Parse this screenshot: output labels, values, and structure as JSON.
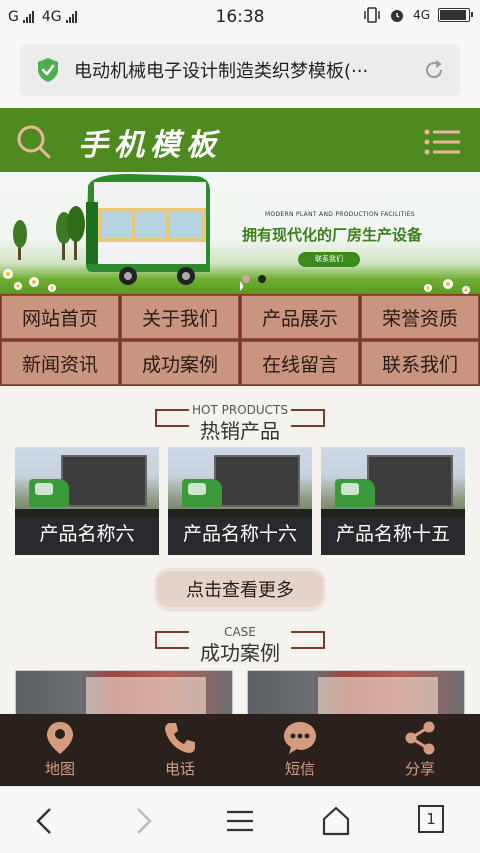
{
  "status_bar": {
    "carrier1": "G",
    "carrier2": "4G",
    "time": "16:38",
    "net": "4G"
  },
  "address_bar": {
    "title": "电动机械电子设计制造类织梦模板(···",
    "secure_icon": "shield-check-icon",
    "reload_icon": "reload-icon"
  },
  "site_header": {
    "logo": "手机模板",
    "color": "#4e8a1f"
  },
  "banner": {
    "subtitle": "MODERN PLANT AND PRODUCTION FACILITIES",
    "headline": "拥有现代化的厂房生产设备",
    "button": "联系我们",
    "active_slide": 2,
    "slides": 2
  },
  "nav": [
    "网站首页",
    "关于我们",
    "产品展示",
    "荣誉资质",
    "新闻资讯",
    "成功案例",
    "在线留言",
    "联系我们"
  ],
  "hot_products": {
    "en": "HOT PRODUCTS",
    "cn": "热销产品",
    "items": [
      "产品名称六",
      "产品名称十六",
      "产品名称十五"
    ],
    "more": "点击查看更多"
  },
  "cases": {
    "en": "CASE",
    "cn": "成功案例"
  },
  "toolbar": {
    "items": [
      {
        "label": "地图",
        "icon": "map-pin-icon"
      },
      {
        "label": "电话",
        "icon": "phone-icon"
      },
      {
        "label": "短信",
        "icon": "chat-icon"
      },
      {
        "label": "分享",
        "icon": "share-icon"
      }
    ],
    "color": "#d69c80"
  },
  "browser_nav": {
    "tab_count": "1"
  }
}
